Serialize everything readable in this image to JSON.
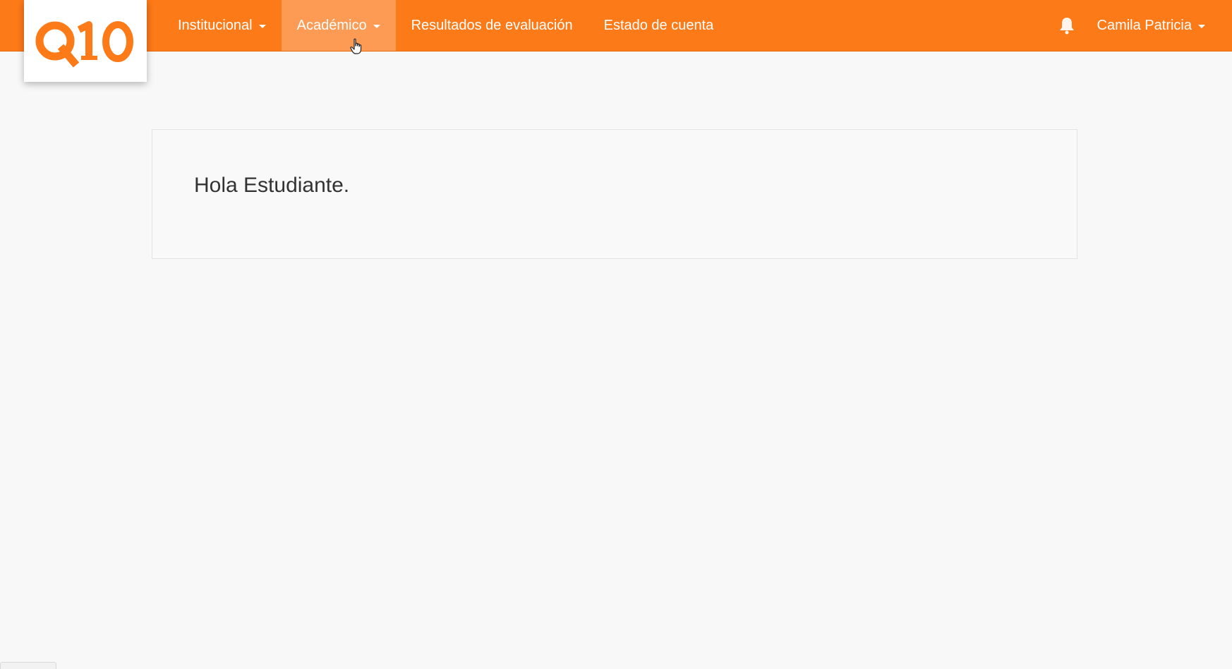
{
  "brand": {
    "logo_text": "Q10",
    "accent_color": "#fd7a18",
    "active_item_color": "#fd9a54"
  },
  "nav": {
    "items": [
      {
        "label": "Institucional",
        "has_dropdown": true,
        "active": false
      },
      {
        "label": "Académico",
        "has_dropdown": true,
        "active": true
      },
      {
        "label": "Resultados de evaluación",
        "has_dropdown": false,
        "active": false
      },
      {
        "label": "Estado de cuenta",
        "has_dropdown": false,
        "active": false
      }
    ]
  },
  "user_menu": {
    "name": "Camila Patricia",
    "icon": "bell-icon"
  },
  "main": {
    "welcome": "Hola Estudiante."
  }
}
